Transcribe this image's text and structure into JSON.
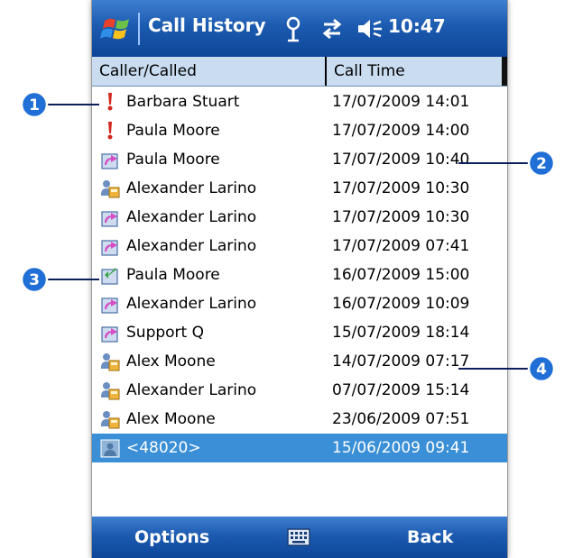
{
  "titlebar": {
    "title": "Call History",
    "clock": "10:47"
  },
  "columns": {
    "caller": "Caller/Called",
    "time": "Call Time"
  },
  "rows": [
    {
      "icon": "missed-call-icon",
      "name": "Barbara Stuart",
      "time": "17/07/2009 14:01"
    },
    {
      "icon": "missed-call-icon",
      "name": "Paula Moore",
      "time": "17/07/2009 14:00"
    },
    {
      "icon": "outgoing-call-icon",
      "name": "Paula Moore",
      "time": "17/07/2009 10:40"
    },
    {
      "icon": "contact-call-icon",
      "name": "Alexander Larino",
      "time": "17/07/2009 10:30"
    },
    {
      "icon": "outgoing-call-icon",
      "name": "Alexander Larino",
      "time": "17/07/2009 10:30"
    },
    {
      "icon": "outgoing-call-icon",
      "name": "Alexander Larino",
      "time": "17/07/2009 07:41"
    },
    {
      "icon": "incoming-call-icon",
      "name": "Paula Moore",
      "time": "16/07/2009 15:00"
    },
    {
      "icon": "outgoing-call-icon",
      "name": "Alexander Larino",
      "time": "16/07/2009 10:09"
    },
    {
      "icon": "outgoing-call-icon",
      "name": "Support Q",
      "time": "15/07/2009 18:14"
    },
    {
      "icon": "contact-call-icon",
      "name": "Alex Moone",
      "time": "14/07/2009 07:17"
    },
    {
      "icon": "contact-call-icon",
      "name": "Alexander Larino",
      "time": "07/07/2009 15:14"
    },
    {
      "icon": "contact-call-icon",
      "name": "Alex Moone",
      "time": "23/06/2009 07:51"
    },
    {
      "icon": "unknown-number-icon",
      "name": "<48020>",
      "time": "15/06/2009 09:41",
      "selected": true
    }
  ],
  "menubar": {
    "left": "Options",
    "right": "Back"
  },
  "callouts": [
    "1",
    "2",
    "3",
    "4"
  ],
  "colors": {
    "titlebar": "#1c5bb0",
    "header": "#c9dcf0",
    "selection": "#3a8fd6",
    "callout": "#1f6fd6"
  }
}
